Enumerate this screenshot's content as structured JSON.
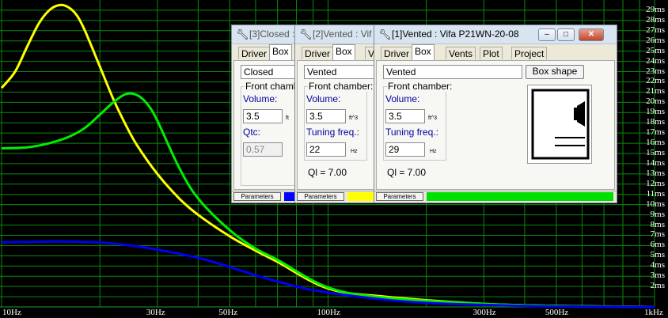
{
  "chart_data": {
    "type": "line",
    "x_scale": "log",
    "xlim": [
      10,
      1000
    ],
    "ylim": [
      0,
      30
    ],
    "x_ticks": [
      "10Hz",
      "30Hz",
      "50Hz",
      "100Hz",
      "300Hz",
      "500Hz",
      "1kHz"
    ],
    "y_ticks": [
      "29ms",
      "28ms",
      "27ms",
      "26ms",
      "25ms",
      "24ms",
      "23ms",
      "22ms",
      "21ms",
      "20ms",
      "19ms",
      "18ms",
      "17ms",
      "16ms",
      "15ms",
      "14ms",
      "13ms",
      "12ms",
      "11ms",
      "10ms",
      "9ms",
      "8ms",
      "7ms",
      "6ms",
      "5ms",
      "4ms",
      "3ms",
      "2ms"
    ],
    "grid": true,
    "background": "#000000",
    "grid_color": "#0a8a0a",
    "series": [
      {
        "color": "#ffff00",
        "x": [
          10,
          11,
          12,
          13,
          14,
          15,
          16,
          17,
          18,
          20,
          22,
          24,
          26,
          30,
          35,
          40,
          50,
          60,
          70,
          100,
          150,
          300,
          500,
          1000
        ],
        "y": [
          21.4,
          23.0,
          25.5,
          27.7,
          29.0,
          29.5,
          29.3,
          28.5,
          27.0,
          23.5,
          20.3,
          17.8,
          15.8,
          13.0,
          10.6,
          9.0,
          6.9,
          5.5,
          4.4,
          1.8,
          1.0,
          0.3,
          0.1,
          0.0
        ]
      },
      {
        "color": "#00ee00",
        "x": [
          10,
          12,
          14,
          16,
          18,
          20,
          22,
          24,
          26,
          28,
          30,
          35,
          40,
          50,
          60,
          70,
          100,
          150,
          300,
          500,
          1000
        ],
        "y": [
          15.5,
          15.6,
          16.0,
          16.6,
          17.5,
          18.8,
          20.0,
          20.8,
          20.7,
          19.8,
          18.2,
          13.6,
          10.6,
          7.5,
          5.7,
          4.6,
          1.9,
          0.9,
          0.3,
          0.1,
          0.0
        ]
      },
      {
        "color": "#0000ee",
        "x": [
          10,
          12,
          15,
          20,
          25,
          30,
          40,
          50,
          60,
          80,
          100,
          150,
          200,
          300,
          500,
          1000
        ],
        "y": [
          6.3,
          6.35,
          6.4,
          6.3,
          6.0,
          5.6,
          4.8,
          3.9,
          3.1,
          2.0,
          1.4,
          0.7,
          0.4,
          0.2,
          0.05,
          0.0
        ]
      }
    ]
  },
  "windows": {
    "closed": {
      "title": "[3]Closed :",
      "tabs": [
        "Driver",
        "Box"
      ],
      "box_type": "Closed",
      "front_chamber": "Front chamber:",
      "volume_label": "Volume:",
      "volume": "3.5",
      "volume_unit": "ft",
      "qtc_label": "Qtc:",
      "qtc": "0.57",
      "params": "Parameters",
      "color": "#0000ff"
    },
    "vented2": {
      "title": "[2]Vented : Vif",
      "tabs": [
        "Driver",
        "Box",
        "V"
      ],
      "box_type": "Vented",
      "front_chamber": "Front chamber:",
      "volume_label": "Volume:",
      "volume": "3.5",
      "volume_unit": "ft^3",
      "tuning_label": "Tuning freq.:",
      "tuning": "22",
      "tuning_unit": "Hz",
      "ql": "Ql = 7.00",
      "params": "Parameters",
      "color": "#ffff00"
    },
    "vented1": {
      "title": "[1]Vented : Vifa P21WN-20-08",
      "tabs": [
        "Driver",
        "Box",
        "Vents",
        "Plot",
        "Project"
      ],
      "box_type": "Vented",
      "box_shape_button": "Box shape",
      "front_chamber": "Front chamber:",
      "volume_label": "Volume:",
      "volume": "3.5",
      "volume_unit": "ft^3",
      "tuning_label": "Tuning freq.:",
      "tuning": "29",
      "tuning_unit": "Hz",
      "ql": "Ql = 7.00",
      "params": "Parameters",
      "color": "#00e000"
    }
  },
  "icons": {
    "wrench": "wrench-icon",
    "minimize": "minimize-icon",
    "maximize": "maximize-icon",
    "close": "close-icon"
  }
}
